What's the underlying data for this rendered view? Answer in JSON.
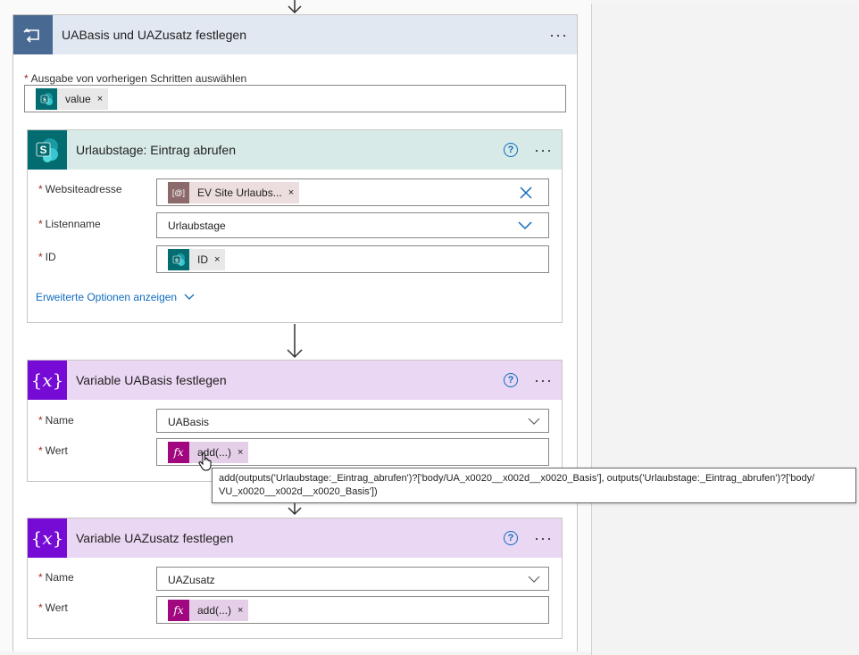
{
  "colors": {
    "apply_each_header": "#e1e8f2",
    "apply_each_icon": "#486991",
    "sharepoint_header": "#d7eae8",
    "sharepoint_icon": "#036c70",
    "variable_header": "#ead7f3",
    "variable_icon": "#770bd6",
    "expression_token": "#e5cfe8",
    "expression_icon": "#a1077e",
    "link": "#0f6cbd",
    "required": "#a4262c"
  },
  "apply_each": {
    "title": "UABasis und UAZusatz festlegen",
    "icon": "loop-icon",
    "more": "···",
    "output_label": "Ausgabe von vorherigen Schritten auswählen",
    "output_token": "value",
    "required_mark": "*"
  },
  "get_item": {
    "title": "Urlaubstage: Eintrag abrufen",
    "icon": "sharepoint-icon",
    "help": "?",
    "more": "···",
    "site_label": "Websiteadresse",
    "site_token": "EV Site Urlaubs...",
    "list_label": "Listenname",
    "list_value": "Urlaubstage",
    "id_label": "ID",
    "id_token": "ID",
    "advanced_link": "Erweiterte Optionen anzeigen"
  },
  "set_basis": {
    "title": "Variable UABasis festlegen",
    "icon": "variable-icon",
    "help": "?",
    "more": "···",
    "name_label": "Name",
    "name_value": "UABasis",
    "value_label": "Wert",
    "value_token": "add(...)"
  },
  "tooltip": {
    "text": "add(outputs('Urlaubstage:_Eintrag_abrufen')?['body/UA_x0020__x002d__x0020_Basis'], outputs('Urlaubstage:_Eintrag_abrufen')?['body/ VU_x0020__x002d__x0020_Basis'])"
  },
  "set_zusatz": {
    "title": "Variable UAZusatz festlegen",
    "icon": "variable-icon",
    "help": "?",
    "more": "···",
    "name_label": "Name",
    "name_value": "UAZusatz",
    "value_label": "Wert",
    "value_token": "add(...)"
  },
  "token_close": "×",
  "required_mark": "*"
}
